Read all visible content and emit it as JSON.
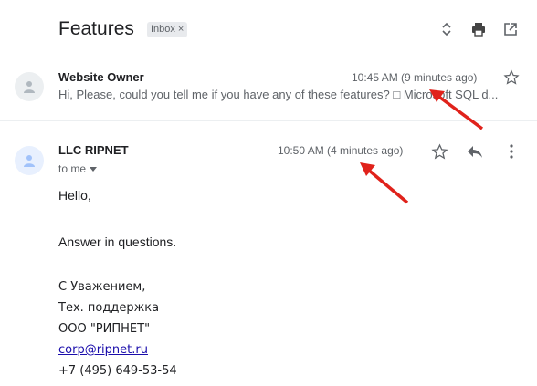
{
  "thread": {
    "subject": "Features",
    "label": "Inbox",
    "label_remove": "×",
    "toolbar_icons": [
      "expand-collapse-icon",
      "print-icon",
      "open-in-new-window-icon"
    ]
  },
  "messages": [
    {
      "sender": "Website Owner",
      "time": "10:45 AM (9 minutes ago)",
      "snippet": "Hi, Please, could you tell me if you have any of these features? □ Microsoft SQL d...",
      "collapsed": true
    },
    {
      "sender": "LLC RIPNET",
      "time": "10:50 AM (4 minutes ago)",
      "to": "to me",
      "collapsed": false,
      "body": {
        "greeting": "Hello,",
        "line": "Answer in questions.",
        "signature": [
          "С Уважением,",
          "Тех. поддержка",
          "ООО \"РИПНЕТ\"",
          "corp@ripnet.ru",
          "+7 (495) 649-53-54"
        ]
      }
    }
  ],
  "annotations": {
    "arrow_color": "#e0221b",
    "count": 2
  },
  "colors": {
    "link": "#1a0dab",
    "text_secondary": "#5f6368",
    "text_primary": "#202124"
  }
}
